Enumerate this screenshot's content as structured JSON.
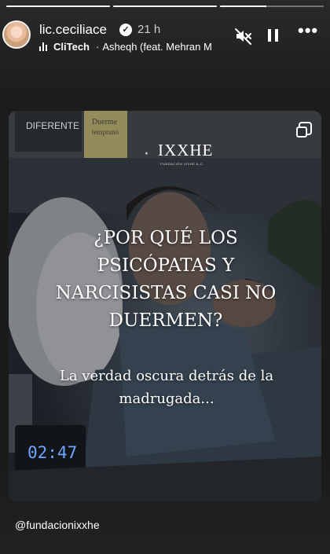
{
  "story": {
    "progress": [
      1,
      1,
      0.45
    ],
    "username": "lic.ceciliace",
    "time_ago": "21 h",
    "music": {
      "artist": "CliTech",
      "separator": "·",
      "track": "Asheqh (feat. Mehran M"
    },
    "icons": {
      "mute": "speaker-muted-icon",
      "pause": "pause-icon",
      "more": "more-options-icon",
      "verified": "verified-badge-icon"
    }
  },
  "card": {
    "logo_name": "IXXHE",
    "logo_subtitle": "FUNDACIÓN IXXHE A.C.",
    "signs": {
      "left": "DIFERENTE",
      "right_line1": "Duerme",
      "right_line2": "temprano"
    },
    "clock_time": "02:47",
    "headline": "¿POR QUÉ LOS PSICÓPATAS Y NARCISISTAS CASI NO DUERMEN?",
    "subline": "La verdad oscura detrás de la madrugada..."
  },
  "mention": "@fundacionixxhe",
  "colors": {
    "background": "#1c1c1c",
    "text": "#ffffff",
    "clock": "#6fa6ff"
  }
}
